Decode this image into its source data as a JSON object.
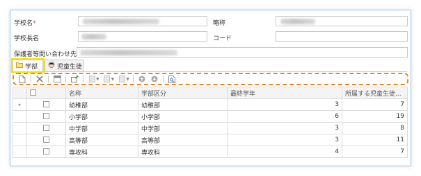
{
  "form": {
    "school_name_label": "学校名",
    "required_mark": "*",
    "abbrev_label": "略称",
    "principal_label": "学校長名",
    "code_label": "コード",
    "contact_label": "保護者等問い合わせ先",
    "code_value": ""
  },
  "tabs": [
    {
      "label": "学部",
      "active": true
    },
    {
      "label": "児童生徒",
      "active": false
    }
  ],
  "toolbar": {
    "icons": [
      "new-icon",
      "delete-icon",
      "save-icon",
      "export-icon",
      "copy-icon",
      "paste-icon",
      "print-icon",
      "move-up-icon",
      "move-down-icon",
      "preview-icon"
    ]
  },
  "grid": {
    "headers": [
      "",
      "",
      "名称",
      "学部区分",
      "最終学年",
      "所属する児童生徒..."
    ],
    "rows": [
      {
        "name": "幼稚部",
        "category": "幼稚部",
        "final_grade": "3",
        "students": "7"
      },
      {
        "name": "小学部",
        "category": "小学部",
        "final_grade": "6",
        "students": "19"
      },
      {
        "name": "中学部",
        "category": "中学部",
        "final_grade": "3",
        "students": "8"
      },
      {
        "name": "高等部",
        "category": "高等部",
        "final_grade": "3",
        "students": "11"
      },
      {
        "name": "専攻科",
        "category": "専攻科",
        "final_grade": "4",
        "students": "7"
      }
    ]
  },
  "colors": {
    "highlight_tab": "#ffe200",
    "toolbar_outline": "#e08a1e",
    "frame_border": "#9ec3ea"
  }
}
